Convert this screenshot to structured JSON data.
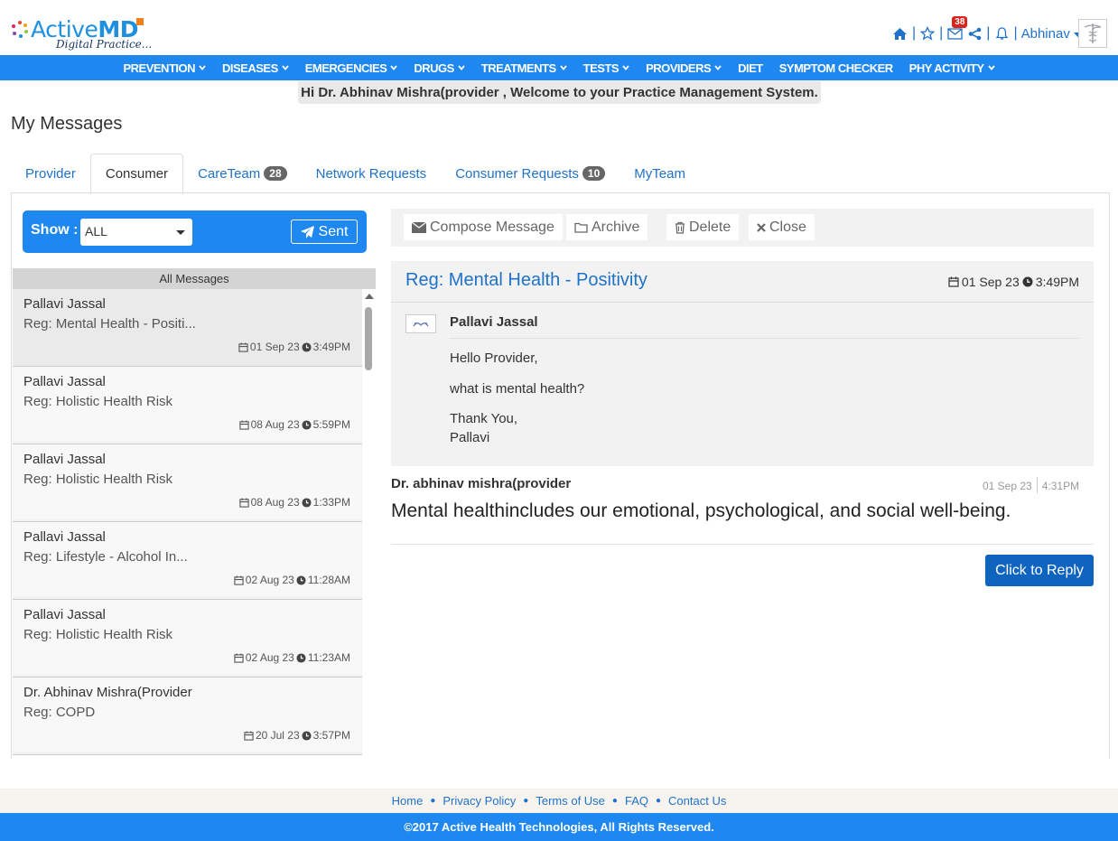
{
  "brand": {
    "name_light": "Active",
    "name_bold": "MD",
    "tagline": "Digital Practice..."
  },
  "toolbar": {
    "mail_badge": "38",
    "user": "Abhinav"
  },
  "nav": [
    {
      "label": "PREVENTION",
      "dropdown": true
    },
    {
      "label": "DISEASES",
      "dropdown": true
    },
    {
      "label": "EMERGENCIES",
      "dropdown": true
    },
    {
      "label": "DRUGS",
      "dropdown": true
    },
    {
      "label": "TREATMENTS",
      "dropdown": true
    },
    {
      "label": "TESTS",
      "dropdown": true
    },
    {
      "label": "PROVIDERS",
      "dropdown": true
    },
    {
      "label": "DIET",
      "dropdown": false
    },
    {
      "label": "SYMPTOM CHECKER",
      "dropdown": false
    },
    {
      "label": "PHY ACTIVITY",
      "dropdown": true
    }
  ],
  "welcome": "Hi Dr. Abhinav Mishra(provider , Welcome to your Practice Management System.",
  "page_title": "My Messages",
  "tabs": [
    {
      "label": "Provider",
      "count": ""
    },
    {
      "label": "Consumer",
      "count": ""
    },
    {
      "label": "CareTeam",
      "count": "28"
    },
    {
      "label": "Network Requests",
      "count": ""
    },
    {
      "label": "Consumer Requests",
      "count": "10"
    },
    {
      "label": "MyTeam",
      "count": ""
    }
  ],
  "filter": {
    "show_label": "Show :",
    "selected": "ALL",
    "sent_label": "Sent"
  },
  "list_header": "All Messages",
  "messages": [
    {
      "sender": "Pallavi Jassal",
      "subject": "Reg: Mental Health - Positi...",
      "date": "01 Sep 23",
      "time": "3:49PM"
    },
    {
      "sender": "Pallavi Jassal",
      "subject": "Reg: Holistic Health Risk",
      "date": "08 Aug 23",
      "time": "5:59PM"
    },
    {
      "sender": "Pallavi Jassal",
      "subject": "Reg: Holistic Health Risk",
      "date": "08 Aug 23",
      "time": "1:33PM"
    },
    {
      "sender": "Pallavi Jassal",
      "subject": "Reg: Lifestyle - Alcohol In...",
      "date": "02 Aug 23",
      "time": "11:28AM"
    },
    {
      "sender": "Pallavi Jassal",
      "subject": "Reg: Holistic Health Risk",
      "date": "02 Aug 23",
      "time": "11:23AM"
    },
    {
      "sender": "Dr. Abhinav Mishra(Provider",
      "subject": "Reg: COPD",
      "date": "20 Jul 23",
      "time": "3:57PM"
    }
  ],
  "actions": {
    "compose": "Compose Message",
    "archive": "Archive",
    "delete": "Delete",
    "close": "Close"
  },
  "detail": {
    "title": "Reg: Mental Health - Positivity",
    "date": "01 Sep 23",
    "time": "3:49PM",
    "from": "Pallavi Jassal",
    "greeting": "Hello Provider,",
    "question": "what is mental health?",
    "thanks": "Thank You,",
    "signature": "Pallavi"
  },
  "reply": {
    "from": "Dr. abhinav mishra(provider",
    "date": "01 Sep 23",
    "time": "4:31PM",
    "body": "Mental healthincludes our emotional, psychological, and social well-being.",
    "button": "Click to Reply"
  },
  "footer": {
    "links": [
      "Home",
      "Privacy Policy",
      "Terms of Use",
      "FAQ",
      "Contact Us"
    ],
    "copyright": "©2017 Active Health Technologies, All Rights Reserved."
  }
}
